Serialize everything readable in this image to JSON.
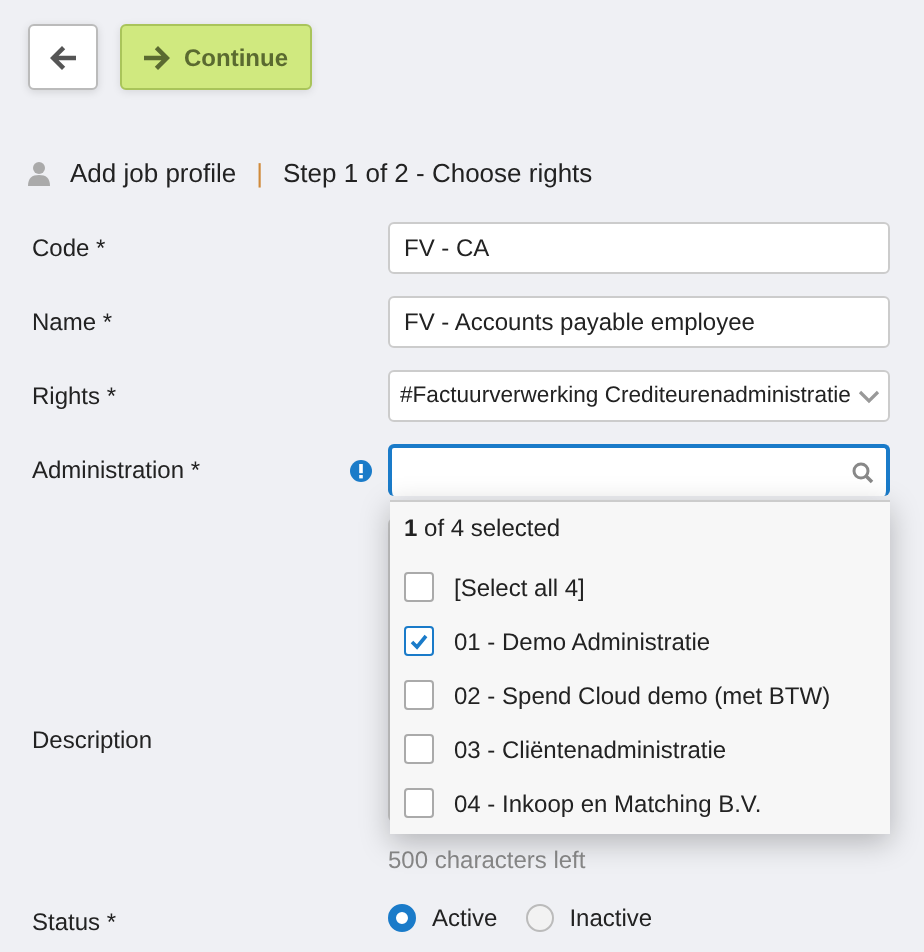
{
  "toolbar": {
    "continue": "Continue"
  },
  "header": {
    "title": "Add job profile",
    "separator": "|",
    "step": "Step 1 of 2 - Choose rights"
  },
  "fields": [
    {
      "label": "Code *",
      "kind": "text",
      "value": "FV - CA"
    },
    {
      "label": "Name *",
      "kind": "text",
      "value": "FV - Accounts payable employee"
    },
    {
      "label": "Rights *",
      "kind": "select",
      "value": "#Factuurverwerking Crediteurenadministratie"
    },
    {
      "label": "Administration *",
      "kind": "multiselect",
      "info": true
    },
    {
      "label": "Description",
      "kind": "textarea",
      "counter": "500 characters left"
    }
  ],
  "dropdown": {
    "summary": "**1** of 4 selected",
    "options": [
      {
        "label": "[Select all 4]",
        "checked": false
      },
      {
        "label": "01 - Demo Administratie",
        "checked": true
      },
      {
        "label": "02 - Spend Cloud demo (met BTW)",
        "checked": false
      },
      {
        "label": "03 - Cliëntenadministratie",
        "checked": false
      },
      {
        "label": "04 - Inkoop en Matching B.V.",
        "checked": false
      }
    ]
  },
  "status": {
    "label": "Status *",
    "options": [
      {
        "label": "Active",
        "selected": true
      },
      {
        "label": "Inactive",
        "selected": false
      }
    ]
  }
}
